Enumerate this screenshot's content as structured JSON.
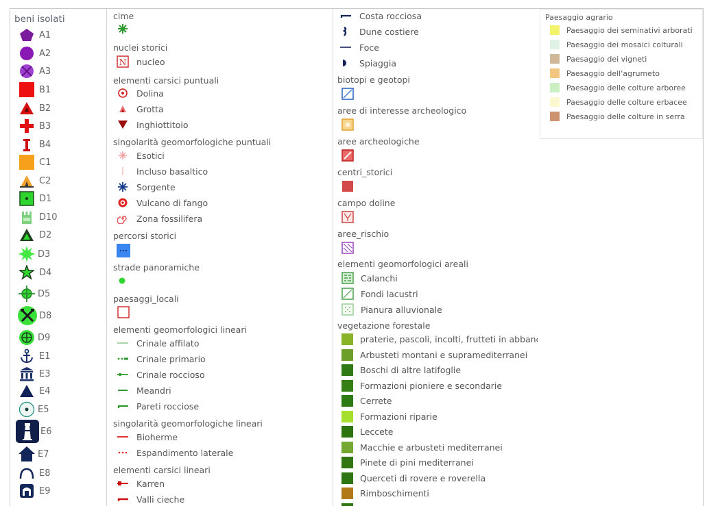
{
  "beni_isolati": {
    "title": "beni isolati",
    "items": [
      {
        "label": "A1",
        "icon": "purple-pentagon-icon"
      },
      {
        "label": "A2",
        "icon": "purple-circle-icon"
      },
      {
        "label": "A3",
        "icon": "purple-crossed-circle-icon"
      },
      {
        "label": "B1",
        "icon": "red-square-icon"
      },
      {
        "label": "B2",
        "icon": "red-triangle-icon"
      },
      {
        "label": "B3",
        "icon": "red-cross-icon"
      },
      {
        "label": "B4",
        "icon": "red-anchor-bar-icon"
      },
      {
        "label": "C1",
        "icon": "orange-square-icon"
      },
      {
        "label": "C2",
        "icon": "orange-tent-icon"
      },
      {
        "label": "D1",
        "icon": "green-square-dot-icon"
      },
      {
        "label": "D10",
        "icon": "green-castle-icon"
      },
      {
        "label": "D2",
        "icon": "green-triangle-icon"
      },
      {
        "label": "D3",
        "icon": "green-splash-icon"
      },
      {
        "label": "D4",
        "icon": "green-star-icon"
      },
      {
        "label": "D5",
        "icon": "green-crosshair-icon"
      },
      {
        "label": "D8",
        "icon": "green-crossed-tools-icon"
      },
      {
        "label": "D9",
        "icon": "green-circle-arrows-icon"
      },
      {
        "label": "E1",
        "icon": "blue-anchor-icon"
      },
      {
        "label": "E3",
        "icon": "blue-museum-icon"
      },
      {
        "label": "E4",
        "icon": "blue-triangle-icon"
      },
      {
        "label": "E5",
        "icon": "teal-target-icon"
      },
      {
        "label": "E6",
        "icon": "navy-lighthouse-icon"
      },
      {
        "label": "E7",
        "icon": "navy-house-icon"
      },
      {
        "label": "E8",
        "icon": "navy-arch-icon"
      },
      {
        "label": "E9",
        "icon": "navy-building-icon"
      }
    ]
  },
  "col2": {
    "cime": {
      "title": "cime",
      "icon": "green-asterisk-icon"
    },
    "nuclei": {
      "title": "nuclei storici",
      "items": [
        {
          "label": "nucleo",
          "icon": "n-square-icon"
        }
      ]
    },
    "carsici": {
      "title": "elementi carsici puntuali",
      "items": [
        {
          "label": "Dolina",
          "icon": "red-ring-dot-icon"
        },
        {
          "label": "Grotta",
          "icon": "red-small-triangle-icon"
        },
        {
          "label": "Inghiottitoio",
          "icon": "red-down-triangle-icon"
        }
      ]
    },
    "singolarita_punt": {
      "title": "singolarità geomorfologiche puntuali",
      "items": [
        {
          "label": "Esotici",
          "icon": "pink-asterisk-icon"
        },
        {
          "label": "Incluso basaltico",
          "icon": "pink-tick-icon"
        },
        {
          "label": "Sorgente",
          "icon": "blue-burst-icon"
        },
        {
          "label": "Vulcano di fango",
          "icon": "red-bullseye-icon"
        },
        {
          "label": "Zona fossilifera",
          "icon": "red-spiral-icon"
        }
      ]
    },
    "percorsi": {
      "title": "percorsi storici",
      "icon": "blue-dotted-square-icon"
    },
    "strade": {
      "title": "strade panoramiche",
      "icon": "green-dot-icon"
    },
    "paesaggi": {
      "title": "paesaggi_locali",
      "icon": "red-outline-square-icon"
    },
    "lineari": {
      "title": "elementi geomorfologici lineari",
      "items": [
        {
          "label": "Crinale affilato",
          "icon": "thin-green-line-icon"
        },
        {
          "label": "Crinale primario",
          "icon": "dotted-green-line-icon"
        },
        {
          "label": "Crinale roccioso",
          "icon": "knobbed-green-line-icon"
        },
        {
          "label": "Meandri",
          "icon": "green-line-icon"
        },
        {
          "label": "Pareti rocciose",
          "icon": "hooked-green-line-icon"
        }
      ]
    },
    "singolarita_lin": {
      "title": "singolarità geomorfologiche lineari",
      "items": [
        {
          "label": "Bioherme",
          "icon": "red-line-icon"
        },
        {
          "label": "Espandimento laterale",
          "icon": "dotted-red-line-icon"
        }
      ]
    },
    "carsici_lin": {
      "title": "elementi carsici lineari",
      "items": [
        {
          "label": "Karren",
          "icon": "red-knob-line-icon"
        },
        {
          "label": "Valli cieche",
          "icon": "red-hook-line-icon"
        }
      ]
    }
  },
  "col3": {
    "costieri": [
      {
        "label": "Costa rocciosa",
        "icon": "navy-hook-line-icon"
      },
      {
        "label": "Dune costiere",
        "icon": "navy-wave-icon"
      },
      {
        "label": "Foce",
        "icon": "navy-line-icon"
      },
      {
        "label": "Spiaggia",
        "icon": "navy-half-disc-icon"
      }
    ],
    "biotopi": {
      "title": "biotopi e geotopi",
      "icon": "blue-hatched-square-icon"
    },
    "interesse_arch": {
      "title": "aree di interesse archeologico",
      "icon": "orange-pattern-square-icon"
    },
    "aree_arch": {
      "title": "aree archeologiche",
      "icon": "red-pattern-square-icon"
    },
    "centri": {
      "title": "centri_storici",
      "icon": "red-filled-square-icon"
    },
    "campo_doline": {
      "title": "campo doline",
      "icon": "red-v-square-icon"
    },
    "aree_rischio": {
      "title": "aree_rischio",
      "icon": "purple-hatched-square-icon"
    },
    "areali": {
      "title": "elementi geomorfologici areali",
      "items": [
        {
          "label": "Calanchi",
          "icon": "green-pattern-square-icon"
        },
        {
          "label": "Fondi lacustri",
          "icon": "green-hatched-square-icon"
        },
        {
          "label": "Pianura alluvionale",
          "icon": "green-dotted-square-icon"
        }
      ]
    },
    "vegetazione": {
      "title": "vegetazione forestale",
      "items": [
        {
          "label": "praterie, pascoli, incolti, frutteti in abbandono",
          "color": "#8ab428"
        },
        {
          "label": "Arbusteti montani e supramediterranei",
          "color": "#6d9f28"
        },
        {
          "label": "Boschi di altre latifoglie",
          "color": "#2f7a14"
        },
        {
          "label": "Formazioni pioniere e secondarie",
          "color": "#357f15"
        },
        {
          "label": "Cerrete",
          "color": "#2e7a12"
        },
        {
          "label": "Formazioni riparie",
          "color": "#a6df2c"
        },
        {
          "label": "Leccete",
          "color": "#2c7410"
        },
        {
          "label": "Macchie e arbusteti mediterranei",
          "color": "#75a830"
        },
        {
          "label": "Pinete di pini mediterranei",
          "color": "#2f7612"
        },
        {
          "label": "Querceti di rovere e roverella",
          "color": "#2e7612"
        },
        {
          "label": "Rimboschimenti",
          "color": "#b07a18"
        },
        {
          "label": "",
          "color": "#2e7612"
        }
      ]
    }
  },
  "col4": {
    "title": "Paesaggio agrario",
    "items": [
      {
        "label": "Paesaggio dei seminativi arborati",
        "color": "#f4f16a"
      },
      {
        "label": "Paesaggio dei mosaici colturali",
        "color": "#dff2e4"
      },
      {
        "label": "Paesaggio dei vigneti",
        "color": "#d2b89a"
      },
      {
        "label": "Paesaggio dell'agrumeto",
        "color": "#f2c67e"
      },
      {
        "label": "Paesaggio delle colture arboree",
        "color": "#c9efc2"
      },
      {
        "label": "Paesaggio delle colture erbacee",
        "color": "#fbf8cf"
      },
      {
        "label": "Paesaggio delle colture in serra",
        "color": "#cc9272"
      }
    ]
  }
}
